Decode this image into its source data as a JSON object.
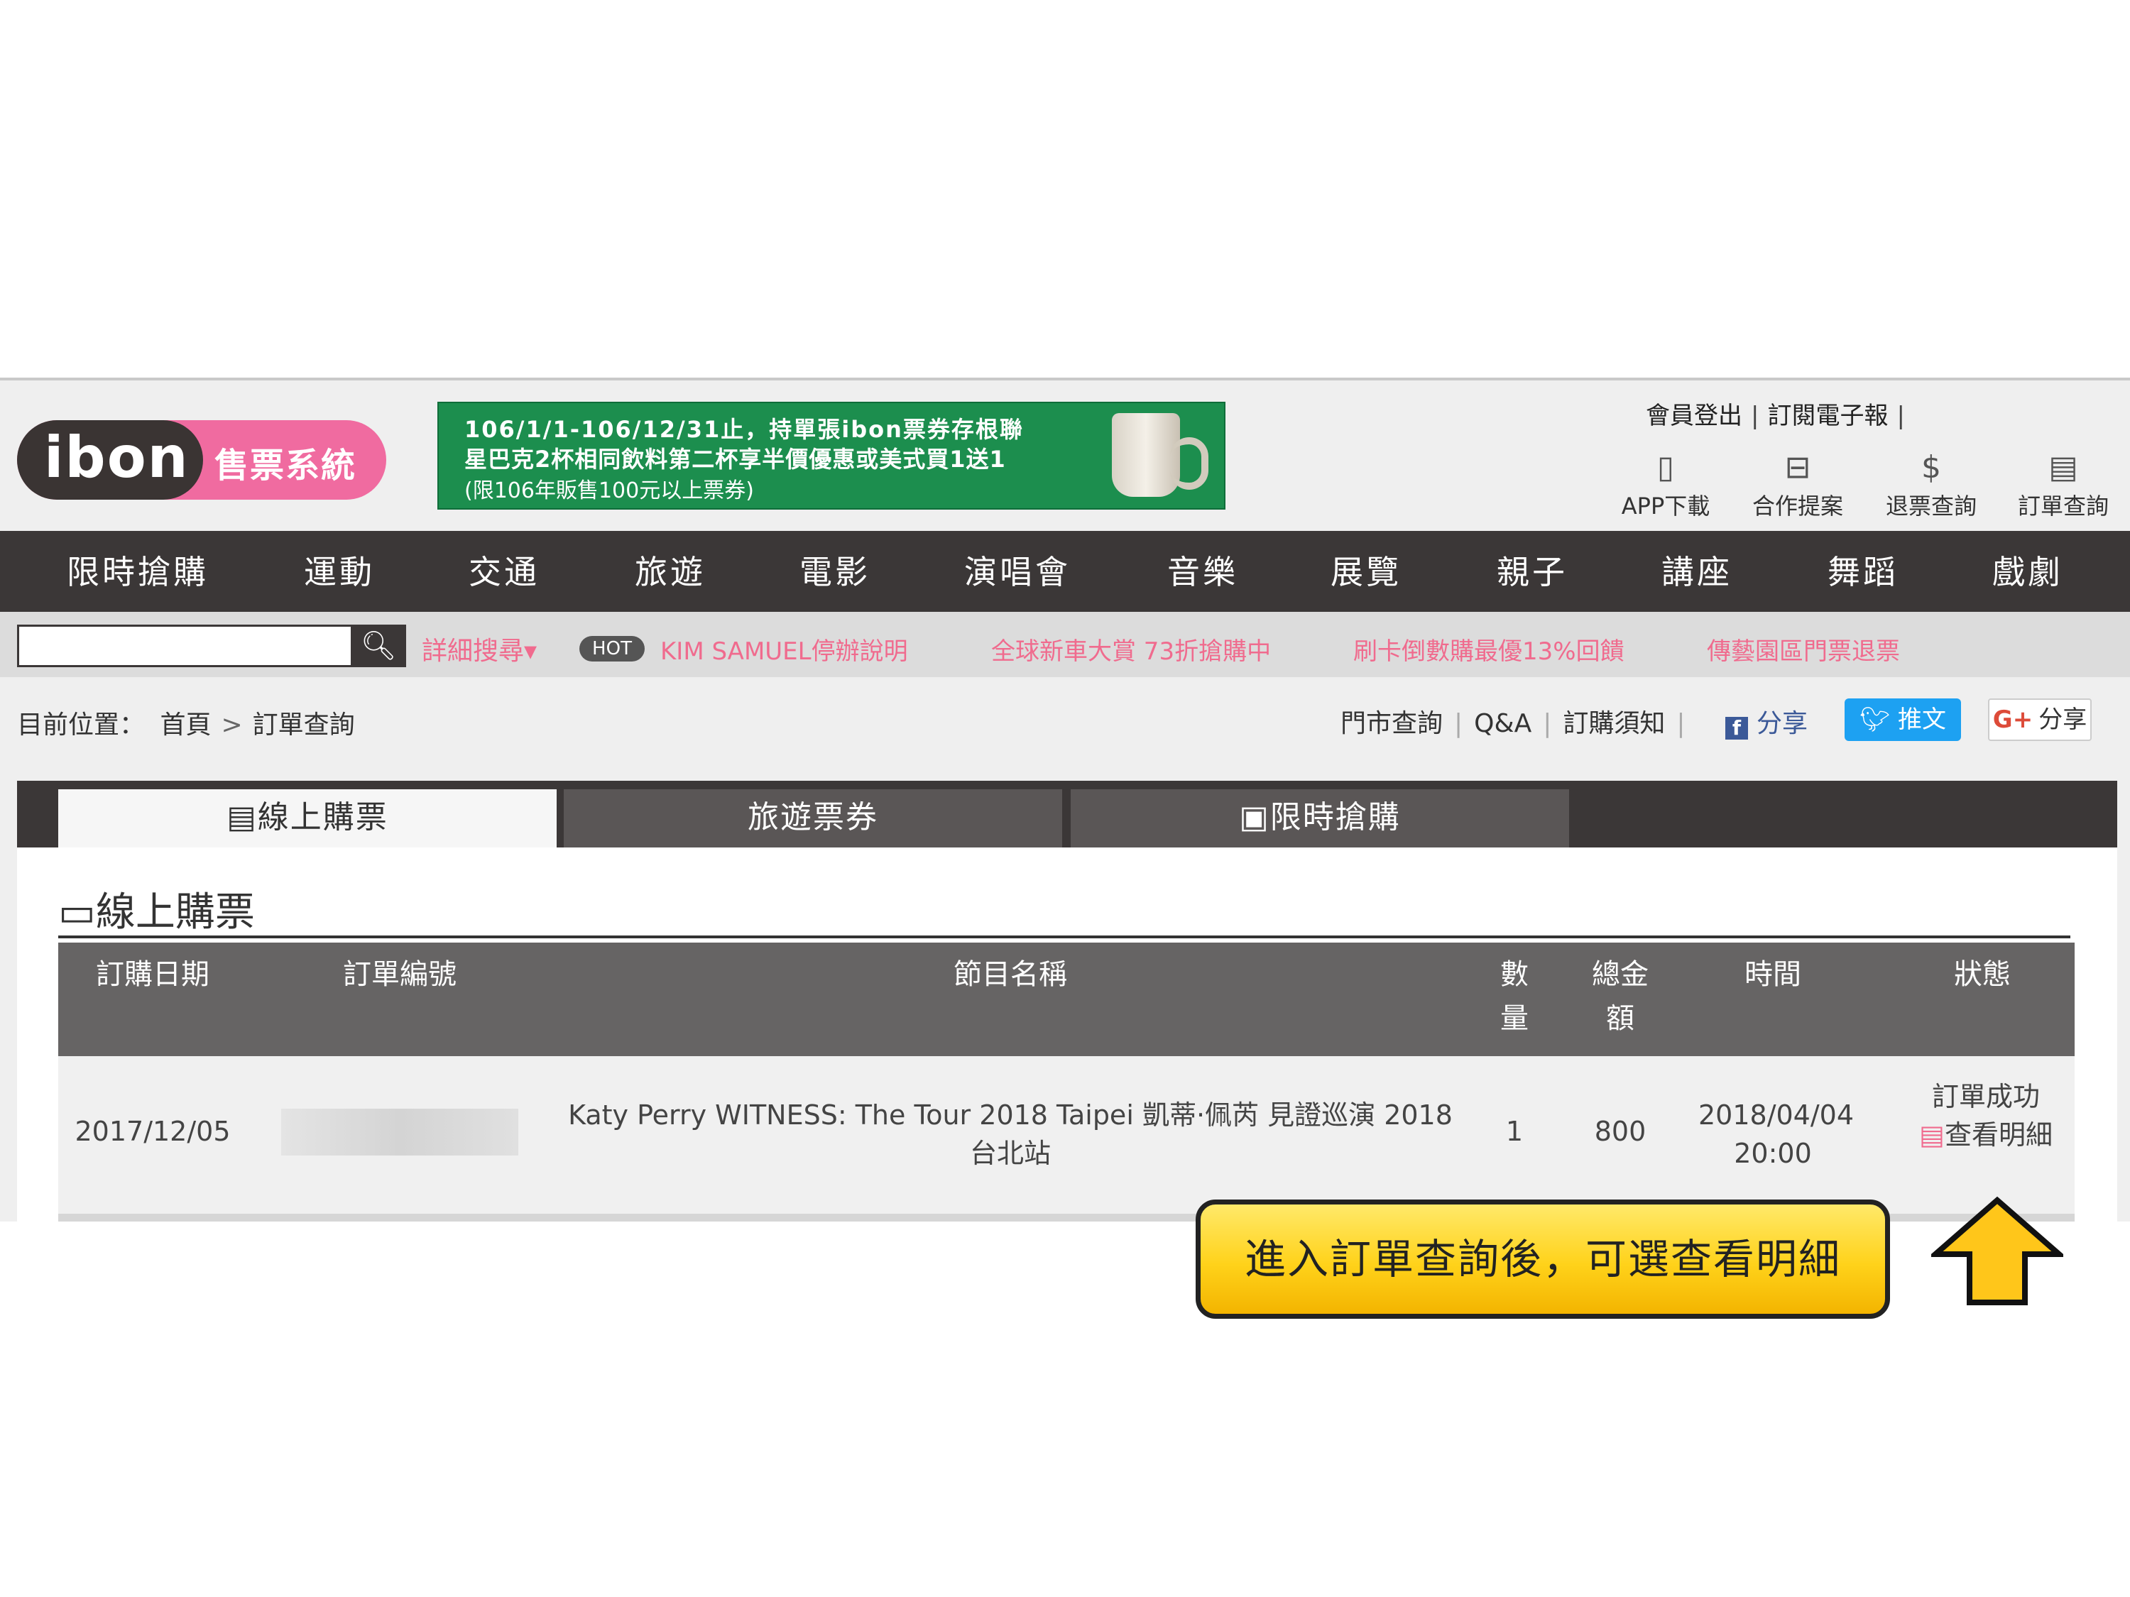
{
  "header": {
    "logo_text": "ibon",
    "logo_subtitle": "售票系統",
    "banner": {
      "line1": "106/1/1-106/12/31止，持單張ibon票券存根聯",
      "line2": "星巴克2杯相同飲料第二杯享半價優惠或美式買1送1",
      "line3": "(限106年販售100元以上票券)"
    },
    "top_links": [
      "會員登出",
      "訂閱電子報"
    ],
    "tools": [
      {
        "icon": "phone-icon",
        "glyph": "▯",
        "label": "APP下載"
      },
      {
        "icon": "briefcase-icon",
        "glyph": "⊟",
        "label": "合作提案"
      },
      {
        "icon": "refund-icon",
        "glyph": "$",
        "label": "退票查詢"
      },
      {
        "icon": "document-icon",
        "glyph": "▤",
        "label": "訂單查詢"
      }
    ]
  },
  "nav": [
    "限時搶購",
    "運動",
    "交通",
    "旅遊",
    "電影",
    "演唱會",
    "音樂",
    "展覽",
    "親子",
    "講座",
    "舞蹈",
    "戲劇"
  ],
  "search": {
    "placeholder": "",
    "advanced_label": "詳細搜尋▾",
    "hot_badge": "HOT",
    "news": [
      "KIM SAMUEL停辦說明",
      "全球新車大賞 73折搶購中",
      "刷卡倒數購最優13%回饋",
      "傳藝園區門票退票"
    ]
  },
  "breadcrumb": {
    "prefix": "目前位置：",
    "home": "首頁",
    "sep": ">",
    "current": "訂單查詢"
  },
  "utility_links": [
    "門市查詢",
    "Q&A",
    "訂購須知"
  ],
  "social": {
    "facebook": "分享",
    "twitter": "推文",
    "gplus_glyph": "G+",
    "gplus": "分享"
  },
  "tabs": [
    {
      "glyph": "▤",
      "label": "線上購票"
    },
    {
      "glyph": "",
      "label": "旅遊票券"
    },
    {
      "glyph": "▣",
      "label": "限時搶購"
    }
  ],
  "section": {
    "glyph": "▭",
    "title": "線上購票"
  },
  "table": {
    "columns": [
      "訂購日期",
      "訂單編號",
      "節目名稱",
      "數量",
      "總金額",
      "時間",
      "狀態"
    ],
    "rows": [
      {
        "date": "2017/12/05",
        "order_no": "",
        "program": "Katy Perry WITNESS: The Tour 2018 Taipei 凱蒂·佩芮 見證巡演 2018 台北站",
        "qty": "1",
        "amount": "800",
        "time": "2018/04/04 20:00",
        "status": "訂單成功",
        "detail_link": "查看明細"
      }
    ]
  },
  "callout": {
    "text": "進入訂單查詢後，可選查看明細"
  },
  "colors": {
    "brand_pink": "#f06ba0",
    "nav_dark": "#3b3737",
    "banner_green": "#1c8e4e",
    "callout_yellow": "#ffd21a"
  }
}
